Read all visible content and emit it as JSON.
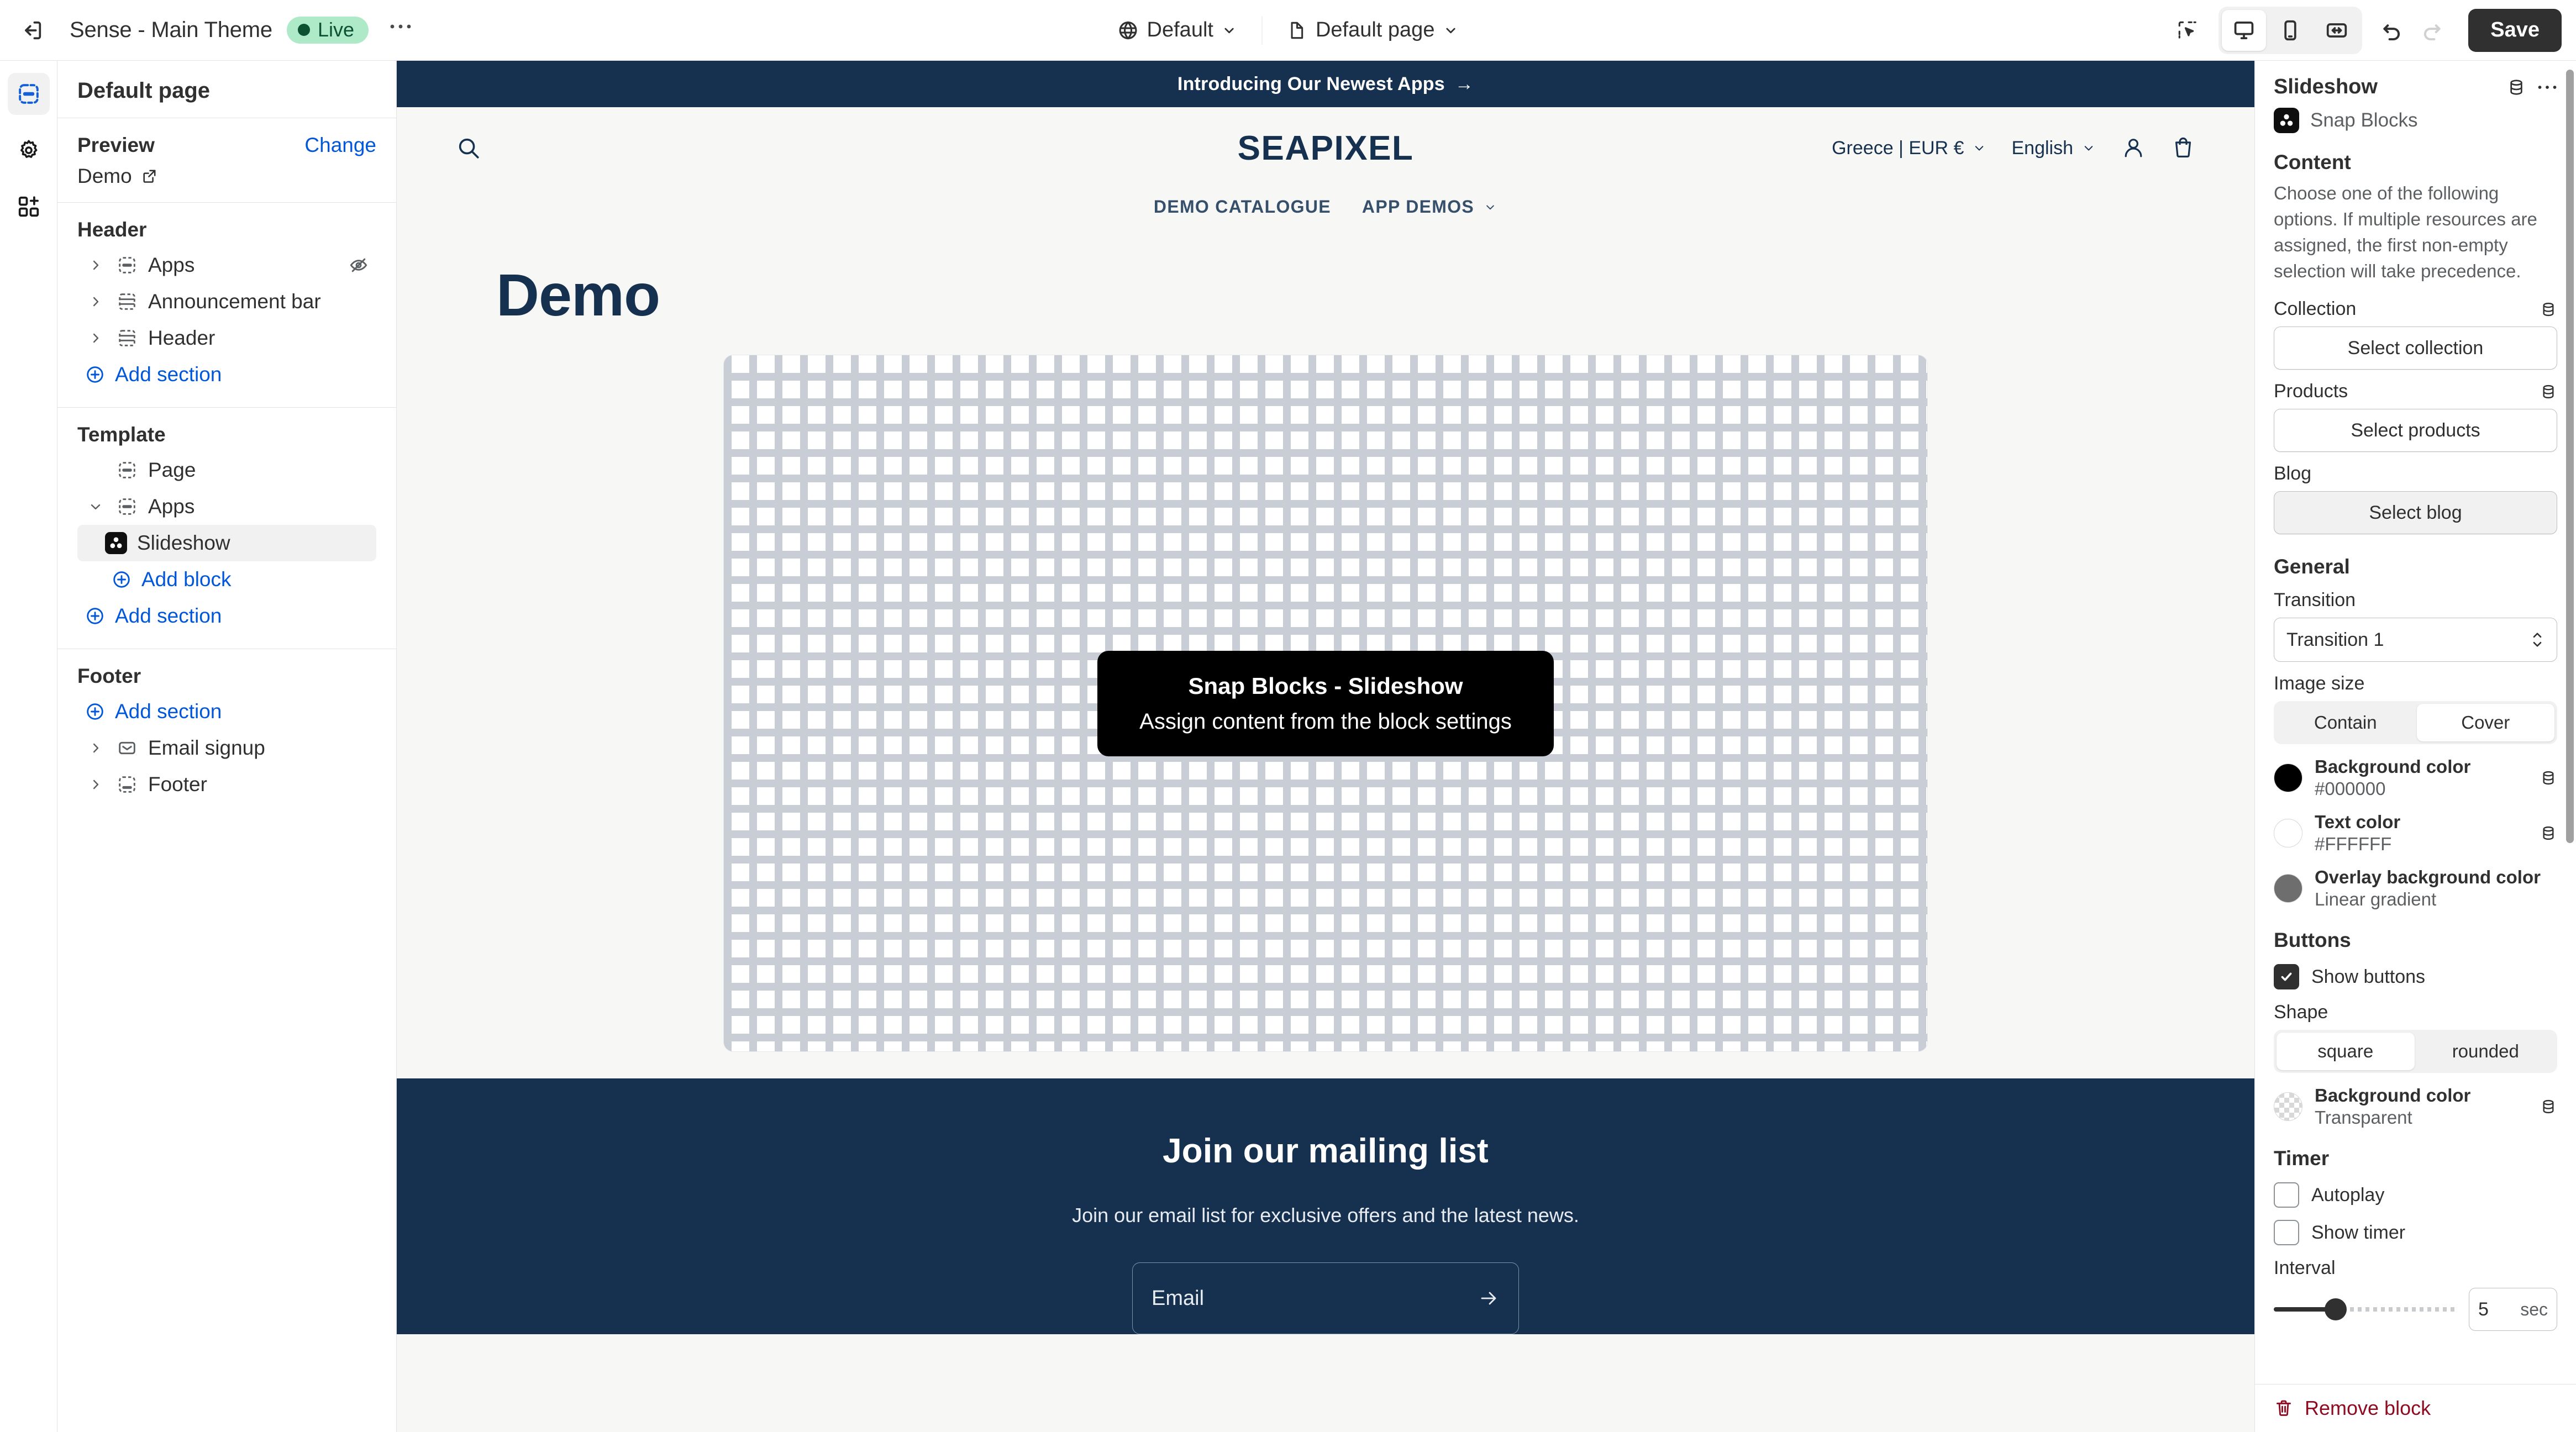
{
  "topbar": {
    "exit_icon": "exit-icon",
    "theme_name": "Sense - Main Theme",
    "live_label": "Live",
    "more_label": "•••",
    "locale_selector": {
      "icon": "globe-icon",
      "value": "Default"
    },
    "page_selector": {
      "icon": "page-icon",
      "value": "Default page"
    },
    "inspector_toggle_icon": "select-pointer-icon",
    "devices": [
      {
        "name": "desktop",
        "icon": "desktop-icon",
        "active": true
      },
      {
        "name": "mobile",
        "icon": "mobile-icon",
        "active": false
      },
      {
        "name": "fullscreen",
        "icon": "fullwidth-icon",
        "active": false
      }
    ],
    "undo_icon": "undo-icon",
    "redo_icon": "redo-icon",
    "save_label": "Save"
  },
  "rail": {
    "items": [
      {
        "name": "sections",
        "icon": "sections-icon",
        "active": true
      },
      {
        "name": "theme-settings",
        "icon": "gear-icon",
        "active": false
      },
      {
        "name": "apps",
        "icon": "apps-add-icon",
        "active": false
      }
    ]
  },
  "sidebar": {
    "page_title": "Default page",
    "preview": {
      "label": "Preview",
      "change_label": "Change",
      "value": "Demo",
      "external_icon": "external-link-icon"
    },
    "groups": [
      {
        "title": "Header",
        "items": [
          {
            "label": "Apps",
            "icon": "apps-section-icon",
            "caret": "right",
            "indent": 0,
            "trailing": "hidden-eye-icon"
          },
          {
            "label": "Announcement bar",
            "icon": "section-icon",
            "caret": "right",
            "indent": 0
          },
          {
            "label": "Header",
            "icon": "section-icon",
            "caret": "right",
            "indent": 0
          }
        ],
        "add_label": "Add section"
      },
      {
        "title": "Template",
        "items": [
          {
            "label": "Page",
            "icon": "apps-section-icon",
            "caret": "none",
            "indent": 0
          },
          {
            "label": "Apps",
            "icon": "apps-section-icon",
            "caret": "down",
            "indent": 0
          },
          {
            "label": "Slideshow",
            "icon": "snap-blocks-icon",
            "caret": "none",
            "indent": 1,
            "selected": true
          }
        ],
        "add_block_label": "Add block",
        "add_label": "Add section"
      },
      {
        "title": "Footer",
        "add_label": "Add section",
        "items": [
          {
            "label": "Email signup",
            "icon": "envelope-icon",
            "caret": "right",
            "indent": 0
          },
          {
            "label": "Footer",
            "icon": "footer-section-icon",
            "caret": "right",
            "indent": 0
          }
        ]
      }
    ]
  },
  "preview": {
    "announcement": {
      "text": "Introducing Our Newest Apps",
      "arrow": "→"
    },
    "store_header": {
      "search_icon": "search-icon",
      "logo": "SEAPIXEL",
      "country_currency": "Greece | EUR €",
      "language": "English",
      "account_icon": "account-icon",
      "cart_icon": "cart-icon",
      "nav": [
        {
          "label": "DEMO CATALOGUE",
          "has_caret": false
        },
        {
          "label": "APP DEMOS",
          "has_caret": true
        }
      ]
    },
    "page_heading": "Demo",
    "slideshow_placeholder": {
      "title": "Snap Blocks - Slideshow",
      "subtitle": "Assign content from the block settings"
    },
    "mailing": {
      "heading": "Join our mailing list",
      "subtext": "Join our email list for exclusive offers and the latest news.",
      "email_placeholder": "Email",
      "submit_icon": "arrow-right-icon"
    }
  },
  "inspector": {
    "title": "Slideshow",
    "header_icons": [
      "dynamic-source-icon",
      "more-actions-icon"
    ],
    "app_name": "Snap Blocks",
    "app_icon": "snap-blocks-icon",
    "content": {
      "title": "Content",
      "help": "Choose one of the following options. If multiple resources are assigned, the first non-empty selection will take precedence.",
      "collection": {
        "label": "Collection",
        "button": "Select collection",
        "dynamic_icon": "dynamic-source-icon"
      },
      "products": {
        "label": "Products",
        "button": "Select products",
        "dynamic_icon": "dynamic-source-icon"
      },
      "blog": {
        "label": "Blog",
        "button": "Select blog",
        "hovered": true
      }
    },
    "general": {
      "title": "General",
      "transition": {
        "label": "Transition",
        "value": "Transition 1"
      },
      "image_size": {
        "label": "Image size",
        "options": [
          "Contain",
          "Cover"
        ],
        "selected": "Cover"
      },
      "colors": [
        {
          "name": "Background color",
          "value": "#000000",
          "swatch": "#000000",
          "dynamic_icon": "dynamic-source-icon"
        },
        {
          "name": "Text color",
          "value": "#FFFFFF",
          "swatch": "#FFFFFF",
          "dynamic_icon": "dynamic-source-icon"
        },
        {
          "name": "Overlay background color",
          "value": "Linear gradient",
          "swatch": "#6e6e6e"
        }
      ]
    },
    "buttons": {
      "title": "Buttons",
      "show_buttons": {
        "label": "Show buttons",
        "checked": true
      },
      "shape": {
        "label": "Shape",
        "options": [
          "square",
          "rounded"
        ],
        "selected": "square"
      },
      "background_color": {
        "name": "Background color",
        "value": "Transparent",
        "dynamic_icon": "dynamic-source-icon"
      }
    },
    "timer": {
      "title": "Timer",
      "autoplay": {
        "label": "Autoplay",
        "checked": false
      },
      "show_timer": {
        "label": "Show timer",
        "checked": false
      },
      "interval": {
        "label": "Interval",
        "value": "5",
        "unit": "sec",
        "min": 0,
        "max": 60,
        "percent": 8
      }
    },
    "remove_block": {
      "label": "Remove block",
      "icon": "trash-icon",
      "color": "#8e0b21"
    }
  }
}
